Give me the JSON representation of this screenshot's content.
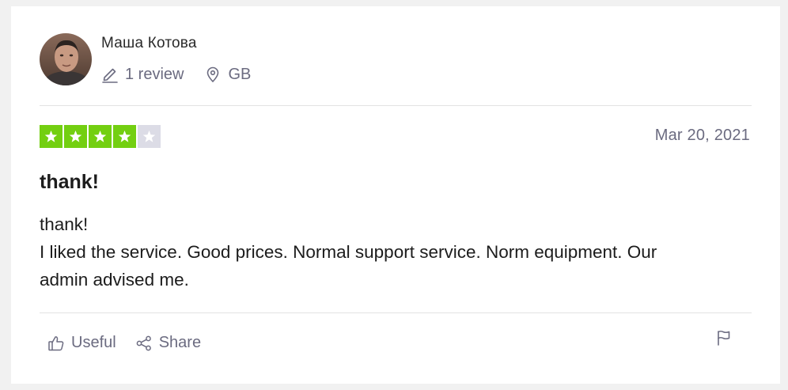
{
  "reviewer": {
    "name": "Маша Котова",
    "reviews_count": "1 review",
    "country": "GB",
    "avatar_icon": "user-photo-avatar"
  },
  "review": {
    "rating": 4,
    "max_rating": 5,
    "date": "Mar 20, 2021",
    "title": "thank!",
    "body_lines": [
      "thank!",
      "I liked the service. Good prices. Normal support service. Norm equipment. Our",
      "admin advised me."
    ]
  },
  "actions": {
    "useful_label": "Useful",
    "share_label": "Share",
    "useful_icon": "thumbs-up-icon",
    "share_icon": "share-icon",
    "flag_icon": "flag-icon"
  },
  "colors": {
    "star_on": "#73cf11",
    "star_off": "#dcdce6",
    "muted_text": "#6b6b80"
  }
}
